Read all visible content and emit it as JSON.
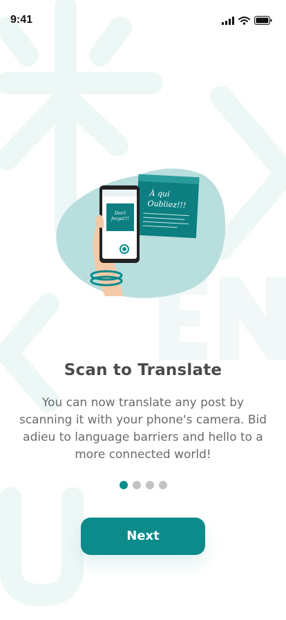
{
  "status_bar": {
    "time": "9:41"
  },
  "onboarding": {
    "title": "Scan to Translate",
    "description": "You can now translate any post by scanning it with your phone's camera. Bid adieu to language barriers and hello to a more connected world!",
    "current_step": 1,
    "total_steps": 4,
    "next_label": "Next"
  },
  "illustration": {
    "note_text_line1": "À qui",
    "note_text_line2": "Oubliez!!!",
    "phone_note_line1": "Don't",
    "phone_note_line2": "forget!!!"
  },
  "colors": {
    "accent": "#0d8a8a",
    "blob": "#b8dedd",
    "dot_inactive": "#c2c2c2",
    "background_letters": "#eef7f6"
  }
}
